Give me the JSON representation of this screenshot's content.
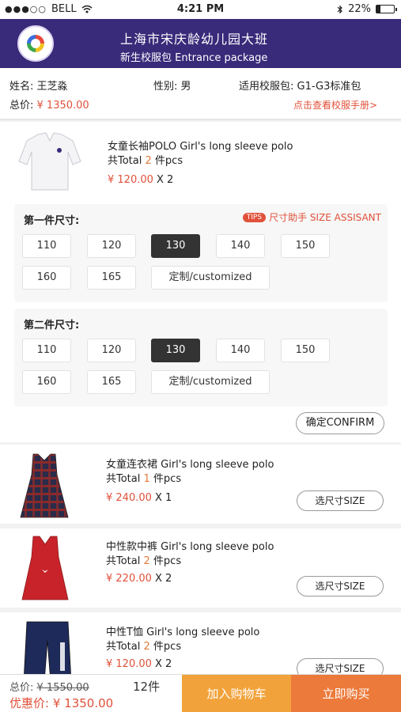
{
  "status_bar": {
    "carrier": "BELL",
    "time": "4:21 PM",
    "battery": "22%",
    "battery_level": 0.22
  },
  "header": {
    "title": "上海市宋庆龄幼儿园大班",
    "subtitle": "新生校服包  Entrance package"
  },
  "info": {
    "name_label": "姓名:",
    "name_value": "王芝淼",
    "gender_label": "性别:",
    "gender_value": "男",
    "package_label": "适用校服包:",
    "package_value": "G1-G3标准包",
    "total_label": "总价:",
    "total_value": "¥ 1350.00",
    "manual_link": "点击查看校服手册>"
  },
  "product1": {
    "name": "女童长袖POLO Girl's long sleeve polo",
    "total_prefix": "共Total ",
    "total_num": "2",
    "total_suffix": " 件pcs",
    "price": "¥ 120.00",
    "qty": " X 2",
    "size_label_1": "第一件尺寸:",
    "size_label_2": "第二件尺寸:",
    "tips_tag": "TIPS",
    "tips_text": "尺寸助手 SIZE ASSISANT",
    "sizes": [
      "110",
      "120",
      "130",
      "140",
      "150",
      "160",
      "165",
      "定制/customized"
    ],
    "confirm": "确定CONFIRM"
  },
  "product2": {
    "name": "女童连衣裙  Girl's long sleeve polo",
    "total_prefix": "共Total ",
    "total_num": "1",
    "total_suffix": " 件pcs",
    "price": "¥ 240.00",
    "qty": " X 1",
    "button": "选尺寸SIZE"
  },
  "product3": {
    "name": "中性款中裤  Girl's long sleeve polo",
    "total_prefix": "共Total ",
    "total_num": "2",
    "total_suffix": " 件pcs",
    "price": "¥ 220.00",
    "qty": " X 2",
    "button": "选尺寸SIZE"
  },
  "product4": {
    "name": "中性T恤  Girl's long sleeve polo",
    "total_prefix": "共Total ",
    "total_num": "2",
    "total_suffix": " 件pcs",
    "price": "¥ 120.00",
    "qty": " X 2",
    "button": "选尺寸SIZE"
  },
  "footer": {
    "total_label": "总价:",
    "original_total": "¥ 1550.00",
    "count": "12件",
    "discount_label": "优惠价:",
    "discount_value": "¥ 1350.00",
    "add_to_cart": "加入购物车",
    "buy_now": "立即购买"
  }
}
